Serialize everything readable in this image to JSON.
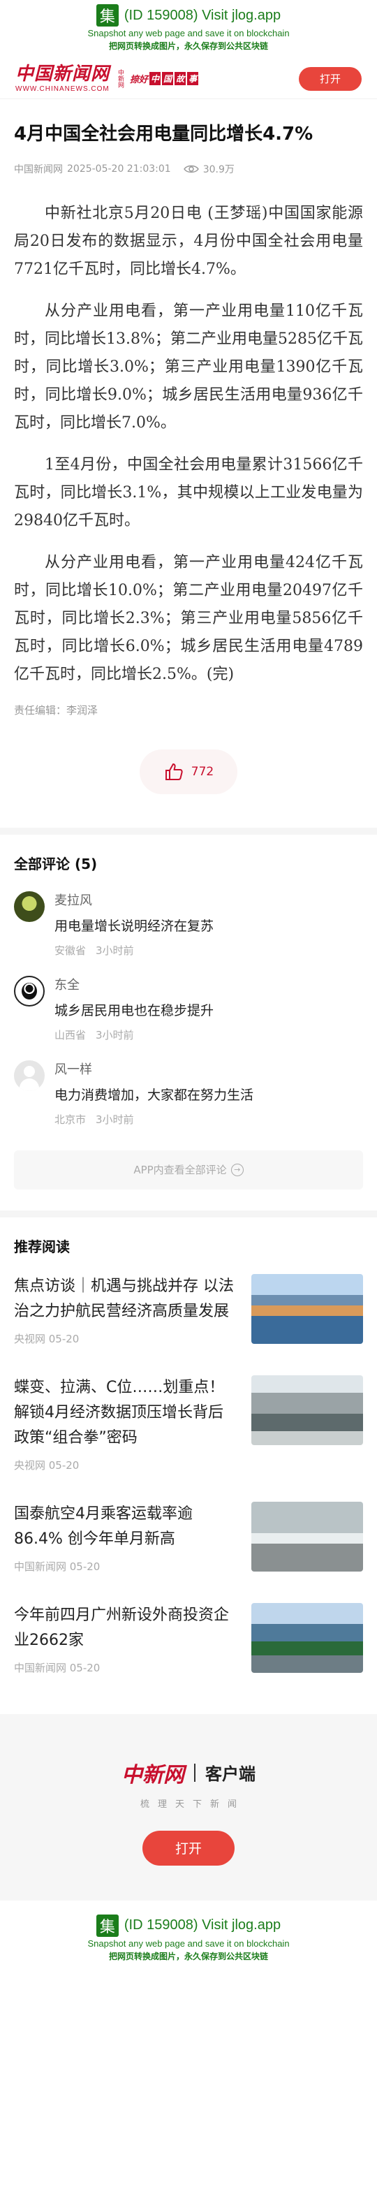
{
  "jlog": {
    "glyph": "集",
    "line1": "(ID 159008) Visit jlog.app",
    "line2": "Snapshot any web page and save it on blockchain",
    "line3": "把网页转换成图片，永久保存到公共区块链"
  },
  "header": {
    "logo_text": "中国新闻网",
    "logo_url": "WWW.CHINANEWS.COM",
    "logo_sub": "中新网",
    "slogan_prefix": "捺好",
    "slogan_boxes": [
      "中",
      "国",
      "故",
      "事"
    ],
    "open_label": "打开"
  },
  "article": {
    "title": "4月中国全社会用电量同比增长4.7%",
    "source": "中国新闻网",
    "time": "2025-05-20 21:03:01",
    "views": "30.9万",
    "paragraphs": [
      "中新社北京5月20日电 (王梦瑶)中国国家能源局20日发布的数据显示，4月份中国全社会用电量7721亿千瓦时，同比增长4.7%。",
      "从分产业用电看，第一产业用电量110亿千瓦时，同比增长13.8%；第二产业用电量5285亿千瓦时，同比增长3.0%；第三产业用电量1390亿千瓦时，同比增长9.0%；城乡居民生活用电量936亿千瓦时，同比增长7.0%。",
      "1至4月份，中国全社会用电量累计31566亿千瓦时，同比增长3.1%，其中规模以上工业发电量为29840亿千瓦时。",
      "从分产业用电看，第一产业用电量424亿千瓦时，同比增长10.0%；第二产业用电量20497亿千瓦时，同比增长2.3%；第三产业用电量5856亿千瓦时，同比增长6.0%；城乡居民生活用电量4789亿千瓦时，同比增长2.5%。(完)"
    ],
    "editor": "责任编辑：李润泽",
    "likes": "772"
  },
  "comments": {
    "title": "全部评论 (5)",
    "items": [
      {
        "user": "麦拉风",
        "text": "用电量增长说明经济在复苏",
        "location": "安徽省",
        "time": "3小时前"
      },
      {
        "user": "东全",
        "text": "城乡居民用电也在稳步提升",
        "location": "山西省",
        "time": "3小时前"
      },
      {
        "user": "风一样",
        "text": "电力消费增加，大家都在努力生活",
        "location": "北京市",
        "time": "3小时前"
      }
    ],
    "more_label": "APP内查看全部评论"
  },
  "recommend": {
    "title": "推荐阅读",
    "items": [
      {
        "title": "焦点访谈｜机遇与挑战并存 以法治之力护航民营经济高质量发展",
        "source": "央视网 05-20"
      },
      {
        "title": "蝶变、拉满、C位……划重点！解锁4月经济数据顶压增长背后政策“组合拳”密码",
        "source": "央视网 05-20"
      },
      {
        "title": "国泰航空4月乘客运载率逾86.4% 创今年单月新高",
        "source": "中国新闻网 05-20"
      },
      {
        "title": "今年前四月广州新设外商投资企业2662家",
        "source": "中国新闻网 05-20"
      }
    ]
  },
  "footer": {
    "logo_text": "中新网",
    "client_label": "客户端",
    "sub_text": "梳理天下新闻",
    "open_label": "打开"
  }
}
